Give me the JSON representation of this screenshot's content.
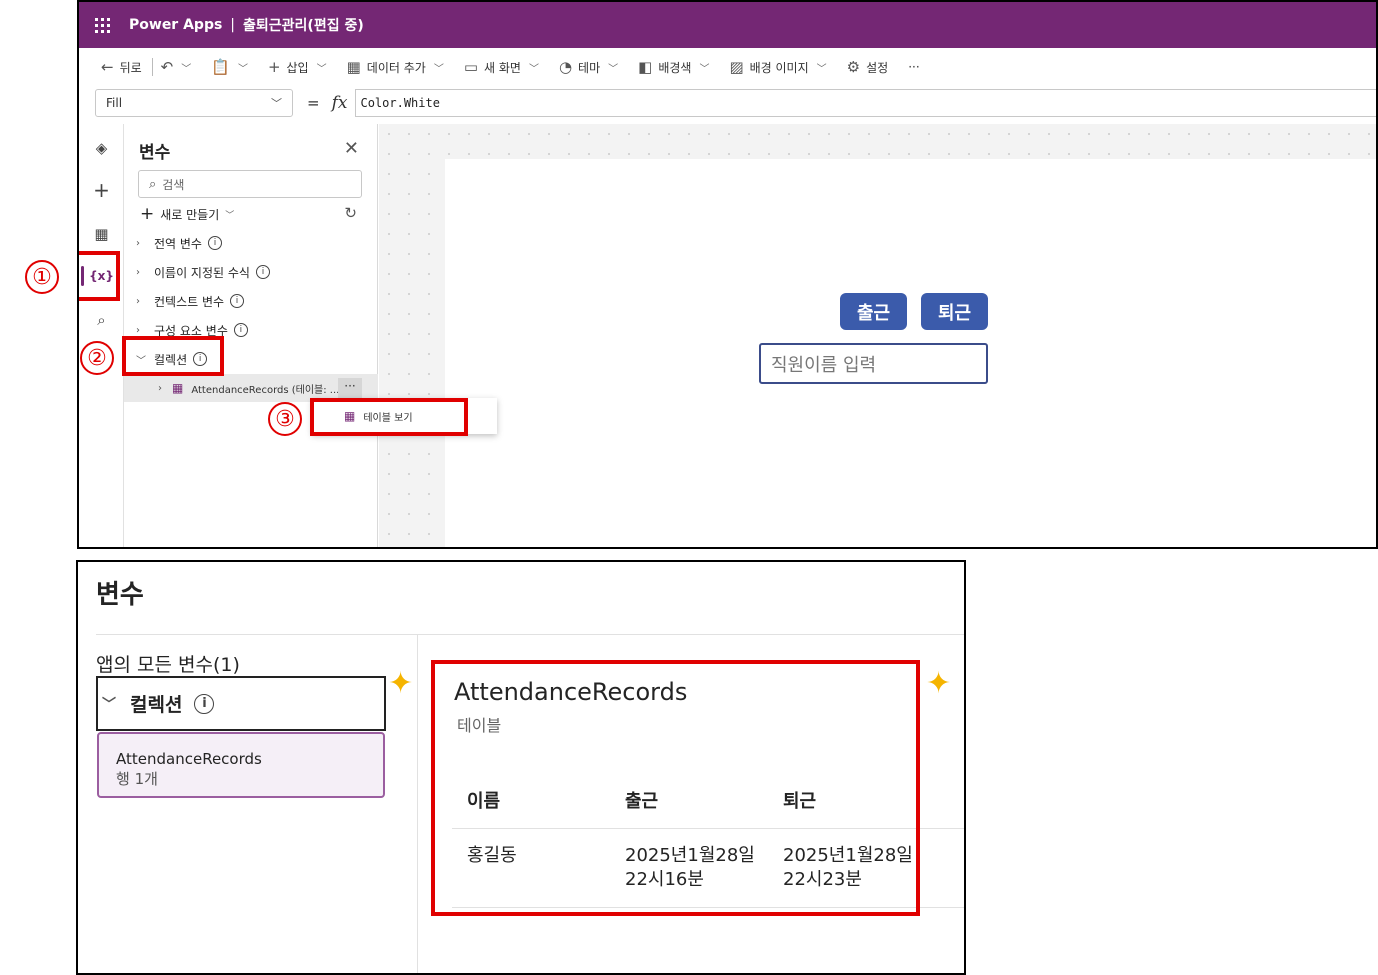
{
  "studio": {
    "app_name": "Power Apps",
    "separator": "|",
    "document_title": "출퇴근관리(편집 중)",
    "toolbar": {
      "back": "뒤로",
      "insert": "삽입",
      "add_data": "데이터 추가",
      "new_screen": "새 화면",
      "theme": "테마",
      "background_color": "배경색",
      "background_image": "배경 이미지",
      "settings": "설정",
      "more": "···"
    },
    "formula": {
      "property": "Fill",
      "equals": "=",
      "fx": "fx",
      "value": "Color.White"
    },
    "variables_panel": {
      "title": "변수",
      "search_placeholder": "검색",
      "new_button": "새로 만들기",
      "sections": [
        {
          "label": "전역 변수"
        },
        {
          "label": "이름이 지정된 수식"
        },
        {
          "label": "컨텍스트 변수"
        },
        {
          "label": "구성 요소 변수"
        },
        {
          "label": "컬렉션"
        }
      ],
      "collection_item": "AttendanceRecords (테이블: ...",
      "more_button": "···"
    },
    "context_menu": {
      "view_table": "테이블 보기"
    },
    "canvas": {
      "clock_in_button": "출근",
      "clock_out_button": "퇴근",
      "name_input_placeholder": "직원이름 입력"
    },
    "callouts": [
      "①",
      "②",
      "③"
    ]
  },
  "variables_view": {
    "title": "변수",
    "all_vars_heading": "앱의 모든 변수(1)",
    "collection_section": "컬렉션",
    "card": {
      "name": "AttendanceRecords",
      "rows": "행 1개"
    },
    "table": {
      "name": "AttendanceRecords",
      "type": "테이블",
      "columns": [
        "이름",
        "출근",
        "퇴근"
      ],
      "rows": [
        {
          "name": "홍길동",
          "clock_in": "2025년1월28일\n22시16분",
          "clock_out": "2025년1월28일\n22시23분"
        }
      ]
    }
  },
  "colors": {
    "titlebar": "#742774",
    "button": "#3b5bab",
    "callout_red": "#e00000",
    "card_border": "#9b5ea0"
  }
}
